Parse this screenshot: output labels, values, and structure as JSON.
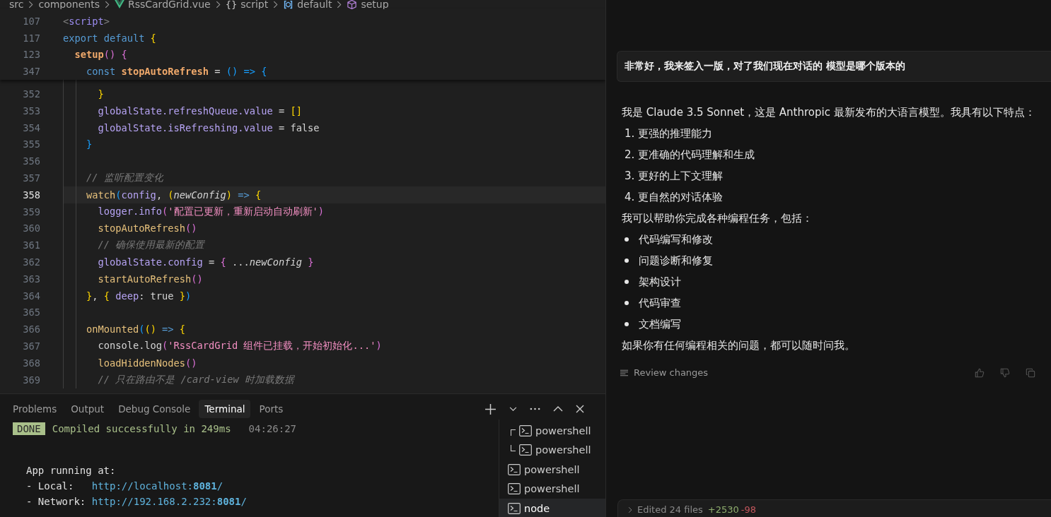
{
  "breadcrumb": [
    {
      "label": "src",
      "kind": "folder"
    },
    {
      "label": "components",
      "kind": "folder"
    },
    {
      "label": "RssCardGrid.vue",
      "kind": "vue-file"
    },
    {
      "label": "script",
      "kind": "braces",
      "glyph": "{}"
    },
    {
      "label": "default",
      "kind": "module"
    },
    {
      "label": "setup",
      "kind": "method"
    }
  ],
  "sticky_lines": [
    {
      "number": "107",
      "tokens": [
        {
          "text": "<",
          "kind": "punct"
        },
        {
          "text": "script",
          "kind": "tag"
        },
        {
          "text": ">",
          "kind": "punct"
        }
      ]
    },
    {
      "number": "117",
      "tokens": [
        {
          "text": "export default ",
          "kind": "keyword"
        },
        {
          "text": "{",
          "kind": "b1"
        }
      ]
    },
    {
      "number": "123",
      "tokens": [
        {
          "text": "  setup",
          "kind": "boldfn"
        },
        {
          "text": "() {",
          "kind": "b2"
        }
      ]
    },
    {
      "number": "347",
      "tokens": [
        {
          "text": "    const ",
          "kind": "keyword"
        },
        {
          "text": "stopAutoRefresh",
          "kind": "boldfn"
        },
        {
          "text": " = ",
          "kind": "plain"
        },
        {
          "text": "() => {",
          "kind": "b3"
        }
      ]
    }
  ],
  "code_lines": [
    {
      "number": "352",
      "active": false,
      "tokens": [
        {
          "text": "      }",
          "kind": "b1"
        }
      ]
    },
    {
      "number": "353",
      "active": false,
      "tokens": [
        {
          "text": "      globalState.refreshQueue.value",
          "kind": "prop"
        },
        {
          "text": " = ",
          "kind": "plain"
        },
        {
          "text": "[]",
          "kind": "b1"
        }
      ]
    },
    {
      "number": "354",
      "active": false,
      "tokens": [
        {
          "text": "      globalState.isRefreshing.value",
          "kind": "prop"
        },
        {
          "text": " = false",
          "kind": "plain"
        }
      ]
    },
    {
      "number": "355",
      "active": false,
      "tokens": [
        {
          "text": "    }",
          "kind": "b3"
        }
      ]
    },
    {
      "number": "356",
      "active": false
    },
    {
      "number": "357",
      "active": false,
      "tokens": [
        {
          "text": "    // 监听配置变化",
          "kind": "comment"
        }
      ]
    },
    {
      "number": "358",
      "active": true,
      "tokens": [
        {
          "text": "    watch",
          "kind": "fn"
        },
        {
          "text": "(",
          "kind": "b3"
        },
        {
          "text": "config",
          "kind": "prop"
        },
        {
          "text": ", ",
          "kind": "plain"
        },
        {
          "text": "(",
          "kind": "b1"
        },
        {
          "text": "newConfig",
          "kind": "param"
        },
        {
          "text": ")",
          "kind": "b1"
        },
        {
          "text": " => ",
          "kind": "keyword"
        },
        {
          "text": "{",
          "kind": "b1"
        }
      ]
    },
    {
      "number": "359",
      "active": false,
      "tokens": [
        {
          "text": "      logger.info",
          "kind": "prop"
        },
        {
          "text": "(",
          "kind": "b2"
        },
        {
          "text": "'配置已更新，重新启动自动刷新'",
          "kind": "string"
        },
        {
          "text": ")",
          "kind": "b2"
        }
      ]
    },
    {
      "number": "360",
      "active": false,
      "tokens": [
        {
          "text": "      stopAutoRefresh",
          "kind": "fn"
        },
        {
          "text": "()",
          "kind": "b2"
        }
      ]
    },
    {
      "number": "361",
      "active": false,
      "tokens": [
        {
          "text": "      // 确保使用最新的配置",
          "kind": "comment"
        }
      ]
    },
    {
      "number": "362",
      "active": false,
      "tokens": [
        {
          "text": "      globalState.config",
          "kind": "prop"
        },
        {
          "text": " = ",
          "kind": "plain"
        },
        {
          "text": "{",
          "kind": "b2"
        },
        {
          "text": " ...",
          "kind": "plain"
        },
        {
          "text": "newConfig",
          "kind": "param"
        },
        {
          "text": " }",
          "kind": "b2"
        }
      ]
    },
    {
      "number": "363",
      "active": false,
      "tokens": [
        {
          "text": "      startAutoRefresh",
          "kind": "fn"
        },
        {
          "text": "()",
          "kind": "b2"
        }
      ]
    },
    {
      "number": "364",
      "active": false,
      "tokens": [
        {
          "text": "    }",
          "kind": "b1"
        },
        {
          "text": ", ",
          "kind": "plain"
        },
        {
          "text": "{",
          "kind": "b1"
        },
        {
          "text": " deep",
          "kind": "prop"
        },
        {
          "text": ": true ",
          "kind": "plain"
        },
        {
          "text": "}",
          "kind": "b1"
        },
        {
          "text": ")",
          "kind": "b3"
        }
      ]
    },
    {
      "number": "365",
      "active": false
    },
    {
      "number": "366",
      "active": false,
      "tokens": [
        {
          "text": "    onMounted",
          "kind": "fn"
        },
        {
          "text": "(",
          "kind": "b3"
        },
        {
          "text": "()",
          "kind": "b1"
        },
        {
          "text": " => ",
          "kind": "keyword"
        },
        {
          "text": "{",
          "kind": "b1"
        }
      ]
    },
    {
      "number": "367",
      "active": false,
      "tokens": [
        {
          "text": "      console.log",
          "kind": "plain"
        },
        {
          "text": "(",
          "kind": "b2"
        },
        {
          "text": "'RssCardGrid 组件已挂载，开始初始化...'",
          "kind": "string"
        },
        {
          "text": ")",
          "kind": "b2"
        }
      ]
    },
    {
      "number": "368",
      "active": false,
      "tokens": [
        {
          "text": "      loadHiddenNodes",
          "kind": "fn"
        },
        {
          "text": "()",
          "kind": "b2"
        }
      ]
    },
    {
      "number": "369",
      "active": false,
      "tokens": [
        {
          "text": "      // 只在路由不是 /card-view 时加载数据",
          "kind": "comment"
        }
      ]
    }
  ],
  "panel_tabs": [
    {
      "label": "Problems",
      "selected": false
    },
    {
      "label": "Output",
      "selected": false
    },
    {
      "label": "Debug Console",
      "selected": false
    },
    {
      "label": "Terminal",
      "selected": true
    },
    {
      "label": "Ports",
      "selected": false
    }
  ],
  "terminal_status": {
    "badge": "DONE",
    "message": "Compiled successfully in 249ms",
    "time": "04:26:27"
  },
  "terminal_lines": [
    {
      "label": "App running at:"
    },
    {
      "label": "- Local:   ",
      "link": "http://localhost:**8081**/"
    },
    {
      "label": "- Network: ",
      "link": "http://192.168.2.232:**8081**/"
    }
  ],
  "terminals": [
    {
      "name": "powershell",
      "kind": "split-top",
      "selected": false
    },
    {
      "name": "powershell",
      "kind": "split-bottom",
      "selected": false
    },
    {
      "name": "powershell",
      "kind": "single",
      "selected": false
    },
    {
      "name": "powershell",
      "kind": "single",
      "selected": false
    },
    {
      "name": "node",
      "kind": "single",
      "selected": true
    }
  ],
  "chat": {
    "user_message": "非常好，我来签入一版，对了我们现在对话的 模型是哪个版本的",
    "blocks": [
      {
        "kind": "paragraph",
        "text": "我是 Claude 3.5 Sonnet，这是 Anthropic 最新发布的大语言模型。我具有以下特点："
      },
      {
        "kind": "ordered",
        "items": [
          {
            "number": "1.",
            "text": "更强的推理能力"
          },
          {
            "number": "2.",
            "text": "更准确的代码理解和生成"
          },
          {
            "number": "3.",
            "text": "更好的上下文理解"
          },
          {
            "number": "4.",
            "text": "更自然的对话体验"
          }
        ]
      },
      {
        "kind": "paragraph",
        "text": "我可以帮助你完成各种编程任务，包括："
      },
      {
        "kind": "bullets",
        "items": [
          {
            "text": "代码编写和修改"
          },
          {
            "text": "问题诊断和修复"
          },
          {
            "text": "架构设计"
          },
          {
            "text": "代码审查"
          },
          {
            "text": "文档编写"
          }
        ]
      },
      {
        "kind": "paragraph",
        "text": "如果你有任何编程相关的问题，都可以随时问我。"
      }
    ],
    "review_label": "Review changes",
    "edits": {
      "label": "Edited 24 files",
      "added": "+2530",
      "removed": "-98"
    }
  }
}
